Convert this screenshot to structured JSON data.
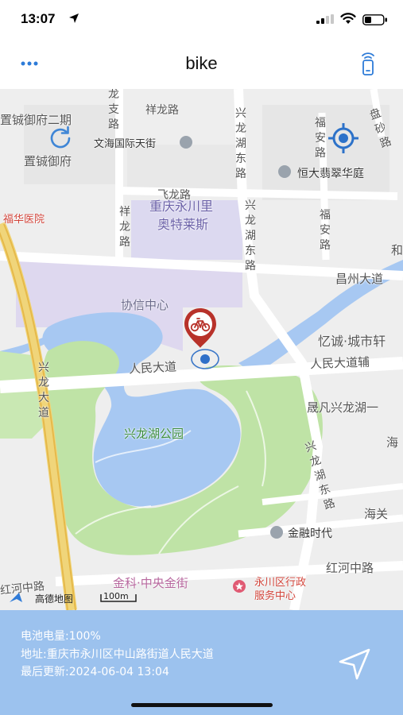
{
  "status_bar": {
    "time": "13:07",
    "location_icon": "location-arrow-icon",
    "signal_icon": "cellular-signal-icon",
    "wifi_icon": "wifi-icon",
    "battery_icon": "battery-icon"
  },
  "nav": {
    "title": "bike",
    "more_icon": "more-dots-icon",
    "device_icon": "device-signal-icon"
  },
  "map": {
    "labels": {
      "zhiyu_fu_2": "置铖御府二期",
      "zhiyu_fu": "置铖御府",
      "wenhai_street": "文海国际天街",
      "hengda": "恒大翡翠华庭",
      "fuhua_hospital": "福华医院",
      "outlets_line1": "重庆永川里",
      "outlets_line2": "奥特莱斯",
      "feilong_road": "飞龙路",
      "changzhou_ave": "昌州大道",
      "xiexin_center": "协信中心",
      "yicheng": "忆诚·城市轩",
      "renmin_ave": "人民大道",
      "renmin_ave_aux": "人民大道辅",
      "shengfan": "晟凡兴龙湖一",
      "xinglong_park": "兴龙湖公园",
      "finance_times": "金融时代",
      "jinke": "金科·中央金街",
      "gov_service_line1": "永川区行政",
      "gov_service_line2": "服务中心",
      "honghe_road": "红河中路",
      "haiguan": "海关",
      "hai": "海",
      "he": "和",
      "honghe_left": "红河中路",
      "v_zhilong": "龙支路",
      "v_xianglong_top": "祥龙路",
      "v_xinglonghu_east_top": "兴龙湖东路",
      "v_fuan_top": "福安路",
      "v_panyi": "盘砂路",
      "v_xianglong": "祥龙路",
      "v_xinglonghu_east": "兴龙湖东路",
      "v_fuan": "福安路",
      "v_xinglong_ave": "兴龙大道",
      "v_xinglonghu_east_lower": "兴龙湖东路"
    },
    "amap_text": "高德地图",
    "scale_text": "100m",
    "refresh_icon": "refresh-icon",
    "locate_icon": "locate-target-icon",
    "bike_marker_icon": "bike-pin-icon"
  },
  "info": {
    "battery": "电池电量:100%",
    "address": "地址:重庆市永川区中山路街道人民大道",
    "updated": "最后更新:2024-06-04 13:04",
    "navigate_icon": "navigate-arrow-icon"
  }
}
